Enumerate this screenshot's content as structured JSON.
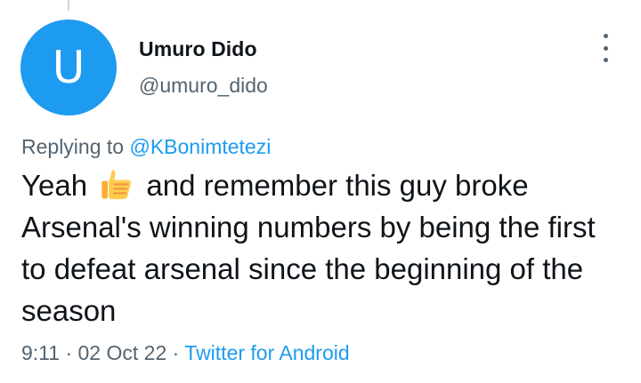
{
  "avatar": {
    "letter": "U",
    "color": "#1d9bf0"
  },
  "author": {
    "name": "Umuro Dido",
    "handle": "@umuro_dido"
  },
  "more_icon": "more-vertical-icon",
  "reply": {
    "prefix": "Replying to",
    "target": "@KBonimtetezi"
  },
  "tweet": {
    "text_before_emoji": "Yeah",
    "emoji": "thumbs-up-emoji",
    "text_after_emoji": "and remember this guy broke Arsenal's winning numbers by being the first to defeat arsenal since the beginning of the season"
  },
  "meta": {
    "time": "9:11",
    "sep": "·",
    "date": "02 Oct 22",
    "source": "Twitter for Android"
  },
  "colors": {
    "accent": "#1d9bf0",
    "secondary_text": "#536471",
    "primary_text": "#0f1419"
  }
}
